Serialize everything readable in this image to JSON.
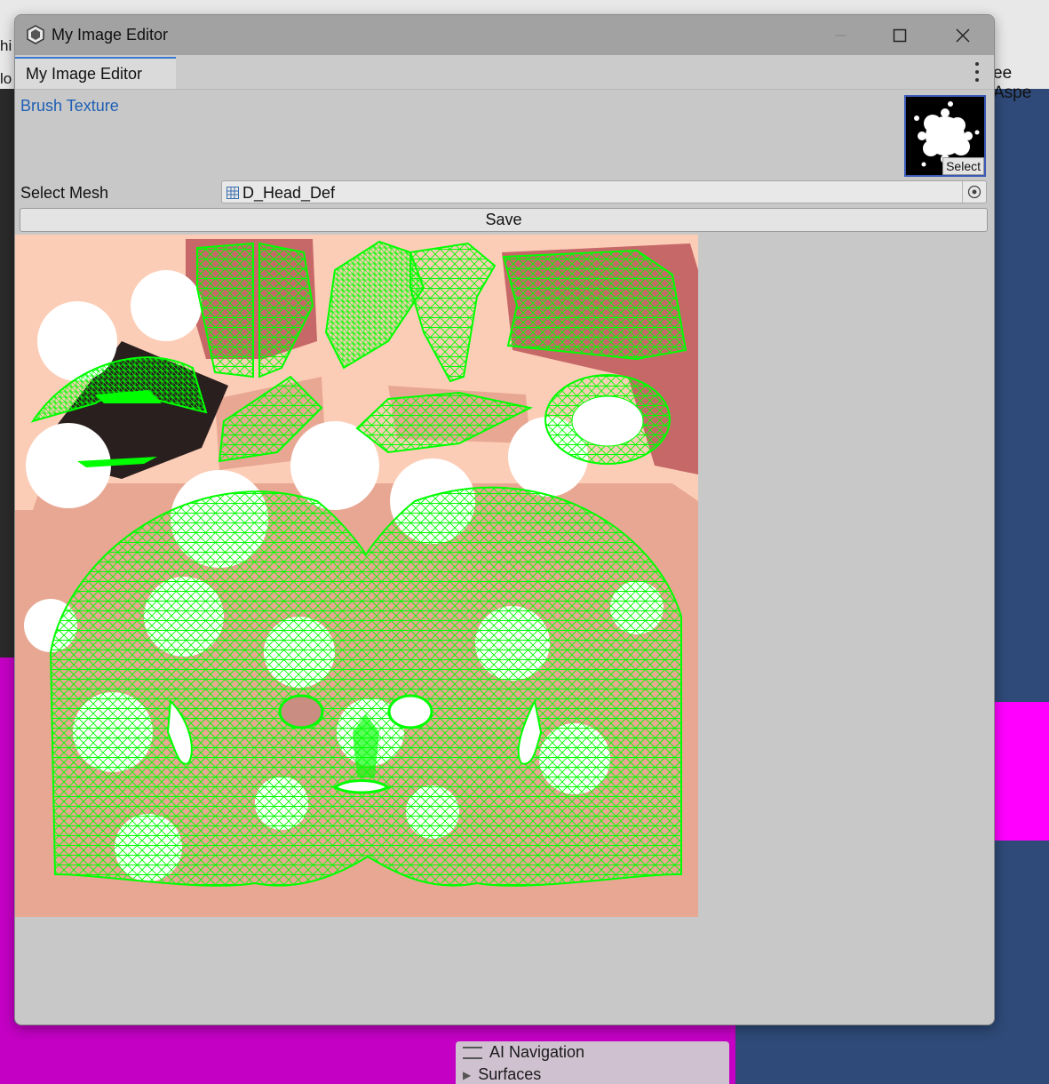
{
  "window": {
    "title": "My Image Editor",
    "tab_label": "My Image Editor"
  },
  "editor": {
    "brush_texture_label": "Brush Texture",
    "thumb_select_label": "Select",
    "select_mesh_label": "Select Mesh",
    "mesh_value": "D_Head_Def",
    "save_label": "Save"
  },
  "background": {
    "left_text_1": "hi",
    "left_text_2": "lo",
    "right_text": "ee Aspe",
    "nav_items": [
      "AI Navigation",
      "Surfaces"
    ]
  },
  "colors": {
    "wireframe": "#00ff00",
    "skin": "#fccdb6",
    "magenta": "#ff00ff",
    "accent": "#3a79d0"
  },
  "icons": [
    "unity-icon",
    "minimize-icon",
    "maximize-icon",
    "close-icon",
    "more-options-icon",
    "mesh-icon",
    "object-picker-icon",
    "hamburger-icon",
    "expand-arrow-icon"
  ]
}
